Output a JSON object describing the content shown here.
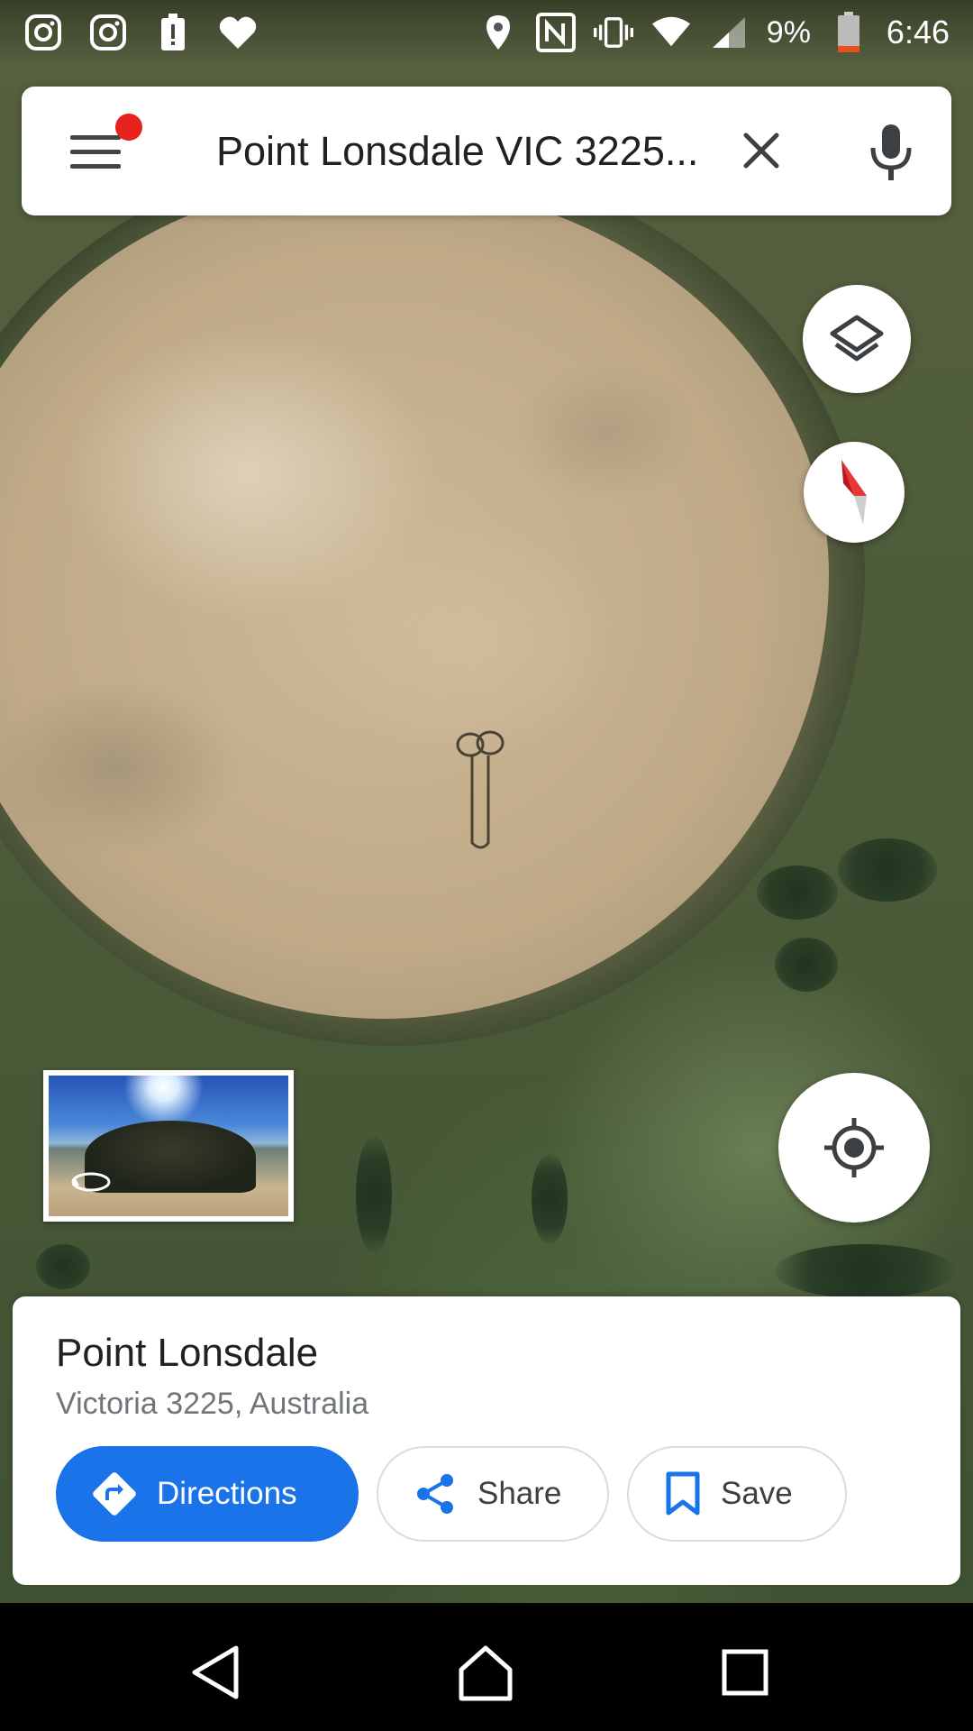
{
  "status_bar": {
    "left_icons": [
      "instagram-icon",
      "instagram-icon",
      "alert-icon",
      "heart-icon"
    ],
    "right_icons": [
      "location-pin-icon",
      "nfc-icon",
      "vibrate-icon",
      "wifi-icon",
      "signal-icon"
    ],
    "battery_percent": "9%",
    "time": "6:46"
  },
  "search": {
    "query": "Point Lonsdale VIC 3225...",
    "menu_icon": "menu-icon",
    "clear_icon": "close-icon",
    "voice_icon": "mic-icon",
    "notification_dot_color": "#e8201e"
  },
  "map": {
    "layers_icon": "layers-icon",
    "compass_icon": "compass-icon",
    "my_location_icon": "my-location-icon",
    "street_view_icon": "rotate-360-icon"
  },
  "place": {
    "name": "Point Lonsdale",
    "address": "Victoria 3225, Australia",
    "actions": {
      "directions": "Directions",
      "share": "Share",
      "save": "Save"
    },
    "accent_color": "#1a73e8"
  },
  "nav_bar": {
    "icons": [
      "back-icon",
      "home-icon",
      "recent-apps-icon"
    ]
  }
}
